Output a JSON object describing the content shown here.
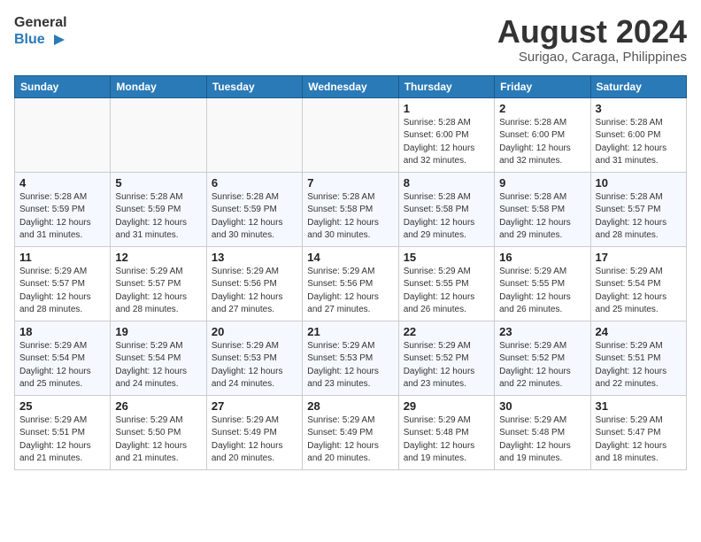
{
  "header": {
    "logo_line1": "General",
    "logo_line2": "Blue",
    "month_year": "August 2024",
    "location": "Surigao, Caraga, Philippines"
  },
  "days_of_week": [
    "Sunday",
    "Monday",
    "Tuesday",
    "Wednesday",
    "Thursday",
    "Friday",
    "Saturday"
  ],
  "weeks": [
    [
      {
        "day": "",
        "info": ""
      },
      {
        "day": "",
        "info": ""
      },
      {
        "day": "",
        "info": ""
      },
      {
        "day": "",
        "info": ""
      },
      {
        "day": "1",
        "info": "Sunrise: 5:28 AM\nSunset: 6:00 PM\nDaylight: 12 hours\nand 32 minutes."
      },
      {
        "day": "2",
        "info": "Sunrise: 5:28 AM\nSunset: 6:00 PM\nDaylight: 12 hours\nand 32 minutes."
      },
      {
        "day": "3",
        "info": "Sunrise: 5:28 AM\nSunset: 6:00 PM\nDaylight: 12 hours\nand 31 minutes."
      }
    ],
    [
      {
        "day": "4",
        "info": "Sunrise: 5:28 AM\nSunset: 5:59 PM\nDaylight: 12 hours\nand 31 minutes."
      },
      {
        "day": "5",
        "info": "Sunrise: 5:28 AM\nSunset: 5:59 PM\nDaylight: 12 hours\nand 31 minutes."
      },
      {
        "day": "6",
        "info": "Sunrise: 5:28 AM\nSunset: 5:59 PM\nDaylight: 12 hours\nand 30 minutes."
      },
      {
        "day": "7",
        "info": "Sunrise: 5:28 AM\nSunset: 5:58 PM\nDaylight: 12 hours\nand 30 minutes."
      },
      {
        "day": "8",
        "info": "Sunrise: 5:28 AM\nSunset: 5:58 PM\nDaylight: 12 hours\nand 29 minutes."
      },
      {
        "day": "9",
        "info": "Sunrise: 5:28 AM\nSunset: 5:58 PM\nDaylight: 12 hours\nand 29 minutes."
      },
      {
        "day": "10",
        "info": "Sunrise: 5:28 AM\nSunset: 5:57 PM\nDaylight: 12 hours\nand 28 minutes."
      }
    ],
    [
      {
        "day": "11",
        "info": "Sunrise: 5:29 AM\nSunset: 5:57 PM\nDaylight: 12 hours\nand 28 minutes."
      },
      {
        "day": "12",
        "info": "Sunrise: 5:29 AM\nSunset: 5:57 PM\nDaylight: 12 hours\nand 28 minutes."
      },
      {
        "day": "13",
        "info": "Sunrise: 5:29 AM\nSunset: 5:56 PM\nDaylight: 12 hours\nand 27 minutes."
      },
      {
        "day": "14",
        "info": "Sunrise: 5:29 AM\nSunset: 5:56 PM\nDaylight: 12 hours\nand 27 minutes."
      },
      {
        "day": "15",
        "info": "Sunrise: 5:29 AM\nSunset: 5:55 PM\nDaylight: 12 hours\nand 26 minutes."
      },
      {
        "day": "16",
        "info": "Sunrise: 5:29 AM\nSunset: 5:55 PM\nDaylight: 12 hours\nand 26 minutes."
      },
      {
        "day": "17",
        "info": "Sunrise: 5:29 AM\nSunset: 5:54 PM\nDaylight: 12 hours\nand 25 minutes."
      }
    ],
    [
      {
        "day": "18",
        "info": "Sunrise: 5:29 AM\nSunset: 5:54 PM\nDaylight: 12 hours\nand 25 minutes."
      },
      {
        "day": "19",
        "info": "Sunrise: 5:29 AM\nSunset: 5:54 PM\nDaylight: 12 hours\nand 24 minutes."
      },
      {
        "day": "20",
        "info": "Sunrise: 5:29 AM\nSunset: 5:53 PM\nDaylight: 12 hours\nand 24 minutes."
      },
      {
        "day": "21",
        "info": "Sunrise: 5:29 AM\nSunset: 5:53 PM\nDaylight: 12 hours\nand 23 minutes."
      },
      {
        "day": "22",
        "info": "Sunrise: 5:29 AM\nSunset: 5:52 PM\nDaylight: 12 hours\nand 23 minutes."
      },
      {
        "day": "23",
        "info": "Sunrise: 5:29 AM\nSunset: 5:52 PM\nDaylight: 12 hours\nand 22 minutes."
      },
      {
        "day": "24",
        "info": "Sunrise: 5:29 AM\nSunset: 5:51 PM\nDaylight: 12 hours\nand 22 minutes."
      }
    ],
    [
      {
        "day": "25",
        "info": "Sunrise: 5:29 AM\nSunset: 5:51 PM\nDaylight: 12 hours\nand 21 minutes."
      },
      {
        "day": "26",
        "info": "Sunrise: 5:29 AM\nSunset: 5:50 PM\nDaylight: 12 hours\nand 21 minutes."
      },
      {
        "day": "27",
        "info": "Sunrise: 5:29 AM\nSunset: 5:49 PM\nDaylight: 12 hours\nand 20 minutes."
      },
      {
        "day": "28",
        "info": "Sunrise: 5:29 AM\nSunset: 5:49 PM\nDaylight: 12 hours\nand 20 minutes."
      },
      {
        "day": "29",
        "info": "Sunrise: 5:29 AM\nSunset: 5:48 PM\nDaylight: 12 hours\nand 19 minutes."
      },
      {
        "day": "30",
        "info": "Sunrise: 5:29 AM\nSunset: 5:48 PM\nDaylight: 12 hours\nand 19 minutes."
      },
      {
        "day": "31",
        "info": "Sunrise: 5:29 AM\nSunset: 5:47 PM\nDaylight: 12 hours\nand 18 minutes."
      }
    ]
  ]
}
